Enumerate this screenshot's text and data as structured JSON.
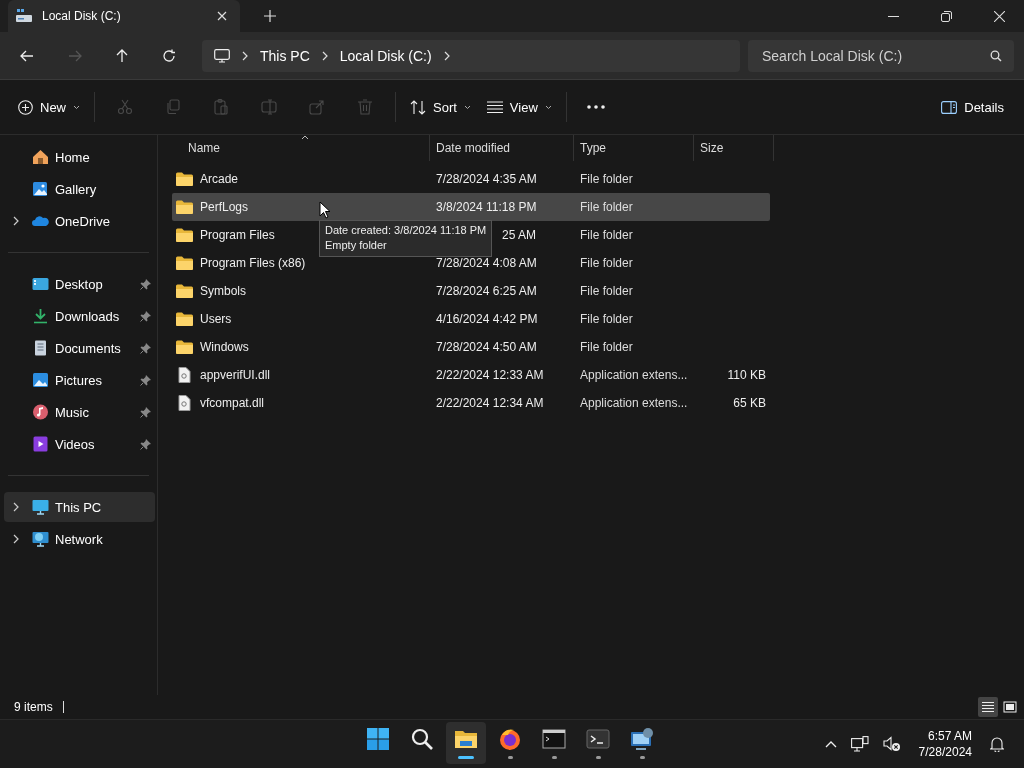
{
  "window": {
    "tab_title": "Local Disk (C:)"
  },
  "address": {
    "crumbs": [
      "This PC",
      "Local Disk (C:)"
    ]
  },
  "search": {
    "placeholder": "Search Local Disk (C:)"
  },
  "toolbar": {
    "new_label": "New",
    "sort_label": "Sort",
    "view_label": "View",
    "details_label": "Details",
    "edit_actions": [
      {
        "kind": "cut",
        "disabled": true
      },
      {
        "kind": "copy",
        "disabled": true
      },
      {
        "kind": "paste",
        "disabled": true
      },
      {
        "kind": "rename",
        "disabled": true
      },
      {
        "kind": "share",
        "disabled": true
      },
      {
        "kind": "delete",
        "disabled": true
      }
    ]
  },
  "sidebar": {
    "groups": [
      [
        {
          "label": "Home",
          "kind": "home",
          "expandable": false,
          "pinned": false,
          "selected": false
        },
        {
          "label": "Gallery",
          "kind": "gallery",
          "expandable": false,
          "pinned": false,
          "selected": false
        },
        {
          "label": "OneDrive",
          "kind": "cloud",
          "expandable": true,
          "pinned": false,
          "selected": false
        }
      ],
      [
        {
          "label": "Desktop",
          "kind": "desktop",
          "expandable": false,
          "pinned": true,
          "selected": false
        },
        {
          "label": "Downloads",
          "kind": "downloads",
          "expandable": false,
          "pinned": true,
          "selected": false
        },
        {
          "label": "Documents",
          "kind": "documents",
          "expandable": false,
          "pinned": true,
          "selected": false
        },
        {
          "label": "Pictures",
          "kind": "pictures",
          "expandable": false,
          "pinned": true,
          "selected": false
        },
        {
          "label": "Music",
          "kind": "music",
          "expandable": false,
          "pinned": true,
          "selected": false
        },
        {
          "label": "Videos",
          "kind": "videos",
          "expandable": false,
          "pinned": true,
          "selected": false
        }
      ],
      [
        {
          "label": "This PC",
          "kind": "pc",
          "expandable": true,
          "pinned": false,
          "selected": true
        },
        {
          "label": "Network",
          "kind": "network",
          "expandable": true,
          "pinned": false,
          "selected": false
        }
      ]
    ]
  },
  "table": {
    "columns": [
      {
        "label": "Name",
        "sorted": true
      },
      {
        "label": "Date modified",
        "sorted": false
      },
      {
        "label": "Type",
        "sorted": false
      },
      {
        "label": "Size",
        "sorted": false
      }
    ],
    "rows": [
      {
        "kind": "folder",
        "name": "Arcade",
        "date": "7/28/2024 4:35 AM",
        "type": "File folder",
        "selected": false,
        "date_covered": false
      },
      {
        "kind": "folder",
        "name": "PerfLogs",
        "date": "3/8/2024 11:18 PM",
        "type": "File folder",
        "selected": true,
        "date_covered": false
      },
      {
        "kind": "folder",
        "name": "Program Files",
        "date": "25 AM",
        "type": "File folder",
        "selected": false,
        "date_covered": true
      },
      {
        "kind": "folder",
        "name": "Program Files (x86)",
        "date": "7/28/2024 4:08 AM",
        "type": "File folder",
        "selected": false,
        "date_covered": false
      },
      {
        "kind": "folder",
        "name": "Symbols",
        "date": "7/28/2024 6:25 AM",
        "type": "File folder",
        "selected": false,
        "date_covered": false
      },
      {
        "kind": "folder",
        "name": "Users",
        "date": "4/16/2024 4:42 PM",
        "type": "File folder",
        "selected": false,
        "date_covered": false
      },
      {
        "kind": "folder",
        "name": "Windows",
        "date": "7/28/2024 4:50 AM",
        "type": "File folder",
        "selected": false,
        "date_covered": false
      },
      {
        "kind": "file",
        "name": "appverifUI.dll",
        "date": "2/22/2024 12:33 AM",
        "type": "Application extens...",
        "size": "110 KB",
        "selected": false,
        "date_covered": false
      },
      {
        "kind": "file",
        "name": "vfcompat.dll",
        "date": "2/22/2024 12:34 AM",
        "type": "Application extens...",
        "size": "65 KB",
        "selected": false,
        "date_covered": false
      }
    ]
  },
  "tooltip": {
    "lines": [
      "Date created: 3/8/2024 11:18 PM",
      "Empty folder"
    ]
  },
  "status_bar": {
    "count": "9 items",
    "views": [
      {
        "kind": "details",
        "selected": true
      },
      {
        "kind": "tiles",
        "selected": false
      }
    ]
  },
  "taskbar": {
    "apps": [
      {
        "kind": "start",
        "running": false,
        "active": false
      },
      {
        "kind": "search",
        "running": false,
        "active": false
      },
      {
        "kind": "explorer",
        "running": true,
        "active": true
      },
      {
        "kind": "firefox",
        "running": true,
        "active": false
      },
      {
        "kind": "cmd",
        "running": true,
        "active": false
      },
      {
        "kind": "terminal",
        "running": true,
        "active": false
      },
      {
        "kind": "remote",
        "running": true,
        "active": false
      }
    ],
    "time": "6:57 AM",
    "date": "7/28/2024"
  }
}
